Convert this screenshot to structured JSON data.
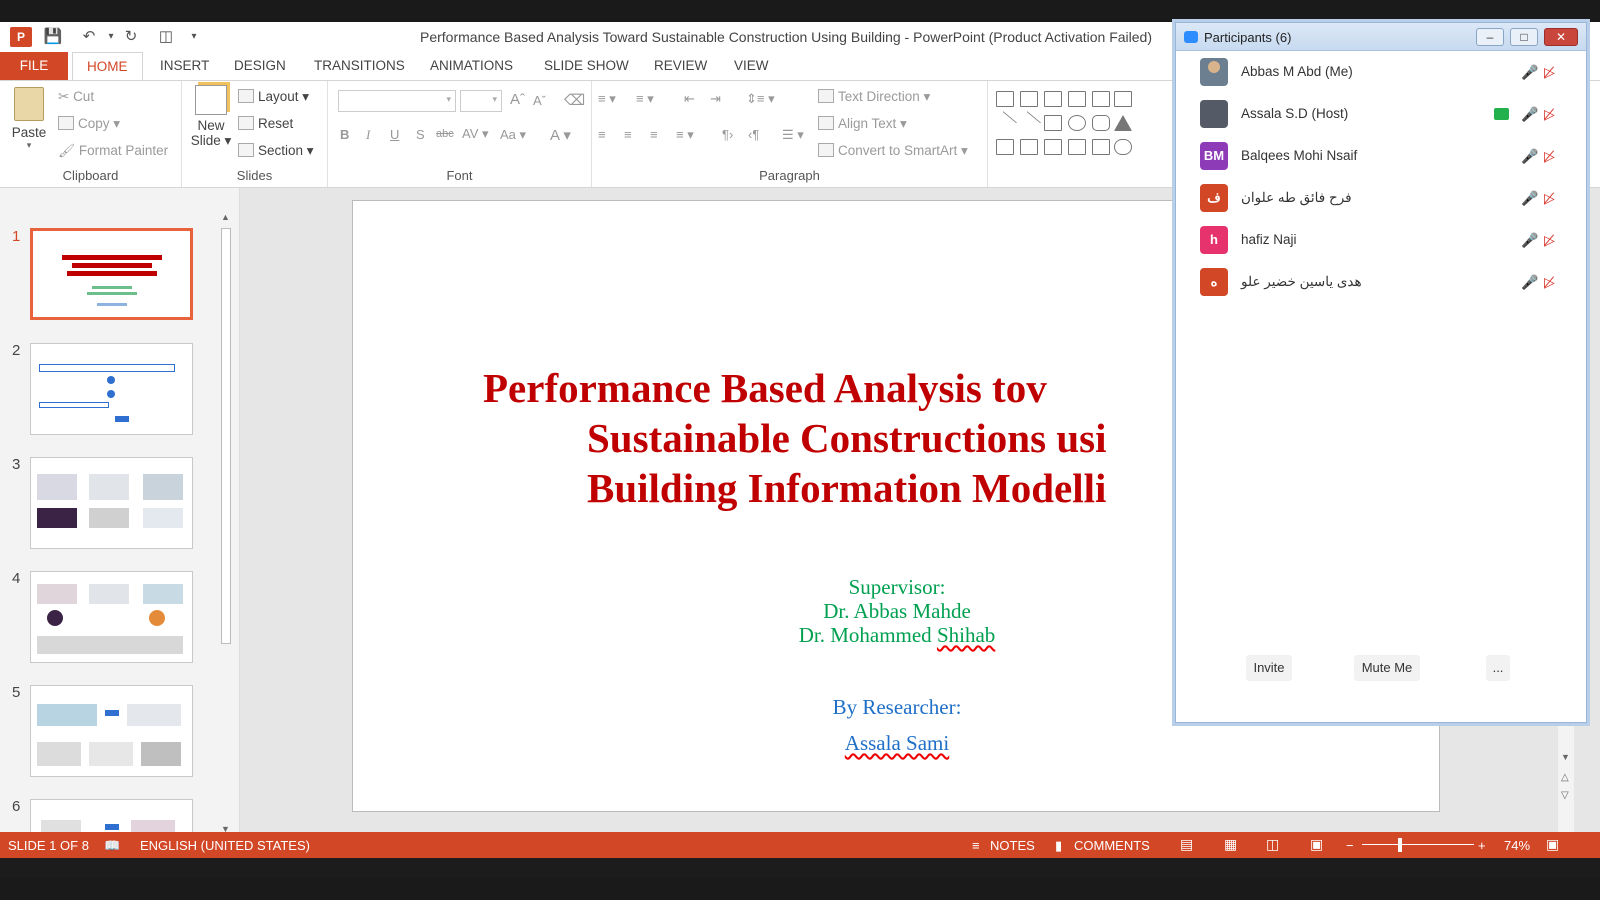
{
  "window": {
    "title": "Performance Based Analysis Toward Sustainable Construction Using Building - PowerPoint (Product Activation Failed)",
    "app_logo": "P"
  },
  "tabs": [
    "FILE",
    "HOME",
    "INSERT",
    "DESIGN",
    "TRANSITIONS",
    "ANIMATIONS",
    "SLIDE SHOW",
    "REVIEW",
    "VIEW"
  ],
  "ribbon": {
    "clipboard": {
      "paste": "Paste",
      "cut": "Cut",
      "copy": "Copy",
      "format_painter": "Format Painter",
      "label": "Clipboard"
    },
    "slides": {
      "new_slide_1": "New",
      "new_slide_2": "Slide",
      "layout": "Layout",
      "reset": "Reset",
      "section": "Section",
      "label": "Slides"
    },
    "font": {
      "label": "Font"
    },
    "paragraph": {
      "text_direction": "Text Direction",
      "align_text": "Align Text",
      "convert_smartart": "Convert to SmartArt",
      "label": "Paragraph"
    }
  },
  "thumbnails": [
    "1",
    "2",
    "3",
    "4",
    "5",
    "6"
  ],
  "slide": {
    "title_lines": [
      "Performance Based Analysis tov",
      "Sustainable Constructions usi",
      "Building Information Modelli"
    ],
    "supervisor_label": "Supervisor:",
    "supervisor_1": "Dr. Abbas Mahde",
    "supervisor_2_prefix": "Dr. Mohammed ",
    "supervisor_2_suffix": "Shihab",
    "researcher_label": "By Researcher:",
    "researcher_name": "Assala Sami"
  },
  "status": {
    "slide_of": "SLIDE 1 OF 8",
    "language": "ENGLISH (UNITED STATES)",
    "notes": "NOTES",
    "comments": "COMMENTS",
    "zoom": "74%"
  },
  "participants_panel": {
    "title": "Participants (6)",
    "participants": [
      {
        "name": "Abbas M Abd (Me)",
        "initials": "",
        "color": "#6b7f90"
      },
      {
        "name": "Assala S.D (Host)",
        "initials": "",
        "color": "#555b66"
      },
      {
        "name": "Balqees Mohi Nsaif",
        "initials": "BM",
        "color": "#8e3bb8"
      },
      {
        "name": "فرح فائق طه علوان",
        "initials": "ف",
        "color": "#d24726"
      },
      {
        "name": "hafiz Naji",
        "initials": "h",
        "color": "#e6336e"
      },
      {
        "name": "هدى ياسين خضير علو",
        "initials": "ه",
        "color": "#d24726"
      }
    ],
    "invite": "Invite",
    "mute_me": "Mute Me",
    "more": "..."
  },
  "colors": {
    "accent": "#d24726",
    "title_red": "#c00000",
    "green": "#00a050",
    "blue": "#1e6fc8"
  }
}
